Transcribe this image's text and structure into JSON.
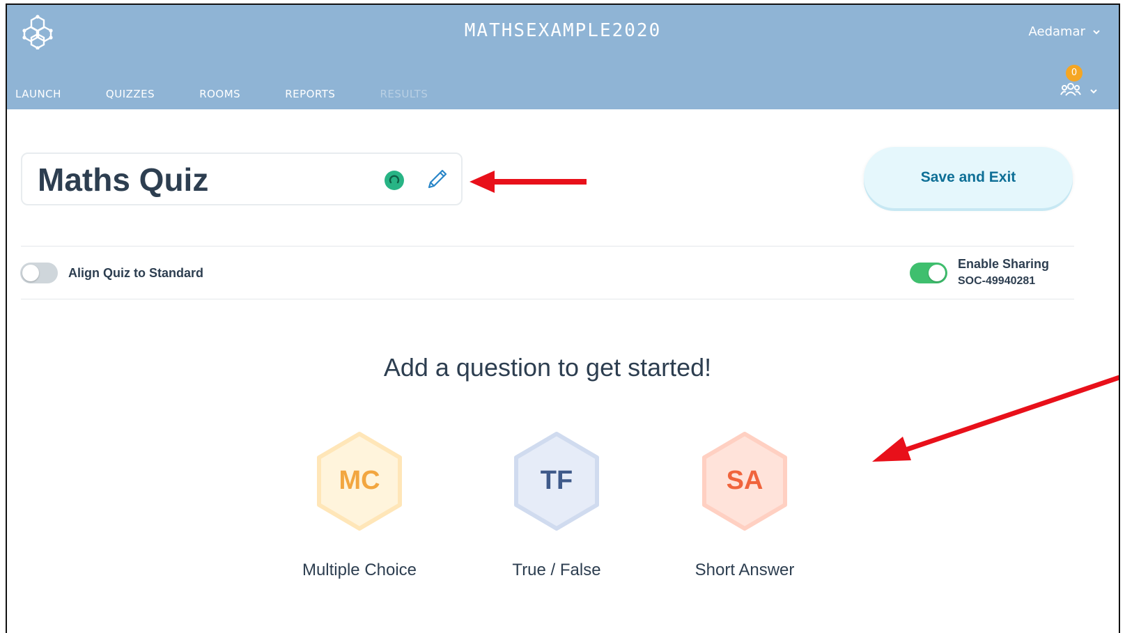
{
  "header": {
    "class_name": "MATHSEXAMPLE2020",
    "user_name": "Aedamar",
    "notification_count": "0",
    "nav": [
      {
        "label": "LAUNCH"
      },
      {
        "label": "QUIZZES"
      },
      {
        "label": "ROOMS"
      },
      {
        "label": "REPORTS"
      },
      {
        "label": "RESULTS"
      }
    ]
  },
  "quiz": {
    "title": "Maths Quiz",
    "save_label": "Save and Exit"
  },
  "settings": {
    "align_label": "Align Quiz to Standard",
    "align_enabled": false,
    "sharing_label": "Enable Sharing",
    "sharing_code": "SOC-49940281",
    "sharing_enabled": true
  },
  "empty_state": {
    "prompt": "Add a question to get started!",
    "question_types": [
      {
        "abbr": "MC",
        "label": "Multiple Choice",
        "text_color": "#f2a640",
        "fill": "#fff4dc"
      },
      {
        "abbr": "TF",
        "label": "True / False",
        "text_color": "#3f5a8a",
        "fill": "#e6ecf8"
      },
      {
        "abbr": "SA",
        "label": "Short Answer",
        "text_color": "#f0643c",
        "fill": "#ffe3da"
      }
    ]
  },
  "colors": {
    "header_bg": "#8fb4d5",
    "accent_green": "#3fbf6e",
    "annotation_red": "#e8101a"
  }
}
